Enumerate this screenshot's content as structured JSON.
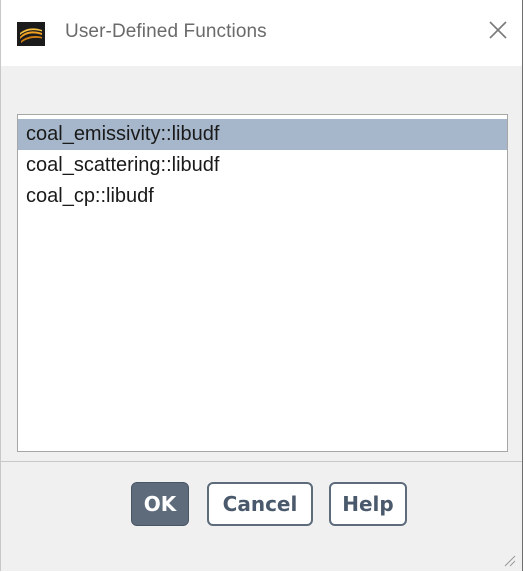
{
  "window": {
    "title": "User-Defined Functions",
    "icon": "app-logo-icon",
    "close_icon": "close-icon"
  },
  "functions_list": {
    "items": [
      {
        "label": "coal_emissivity::libudf",
        "selected": true
      },
      {
        "label": "coal_scattering::libudf",
        "selected": false
      },
      {
        "label": "coal_cp::libudf",
        "selected": false
      }
    ],
    "selection_color": "#a6b7cb"
  },
  "buttons": {
    "ok": "OK",
    "cancel": "Cancel",
    "help": "Help"
  },
  "colors": {
    "primary_button": "#5d6b7b",
    "title_text": "#6a6a6a"
  }
}
